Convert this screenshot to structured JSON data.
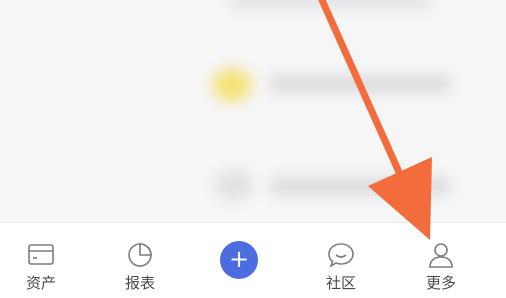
{
  "tabbar": {
    "tabs": [
      {
        "label": "资产",
        "icon": "wallet-card-icon"
      },
      {
        "label": "报表",
        "icon": "pie-chart-icon"
      },
      {
        "label": "社区",
        "icon": "chat-bubble-icon"
      },
      {
        "label": "更多",
        "icon": "user-icon"
      }
    ],
    "add": {
      "label": "+"
    }
  },
  "annotation": {
    "arrow_color": "#f26c3c"
  },
  "colors": {
    "accent": "#4c6ce0",
    "icon": "#7c7c80",
    "label": "#4a4a4a"
  }
}
